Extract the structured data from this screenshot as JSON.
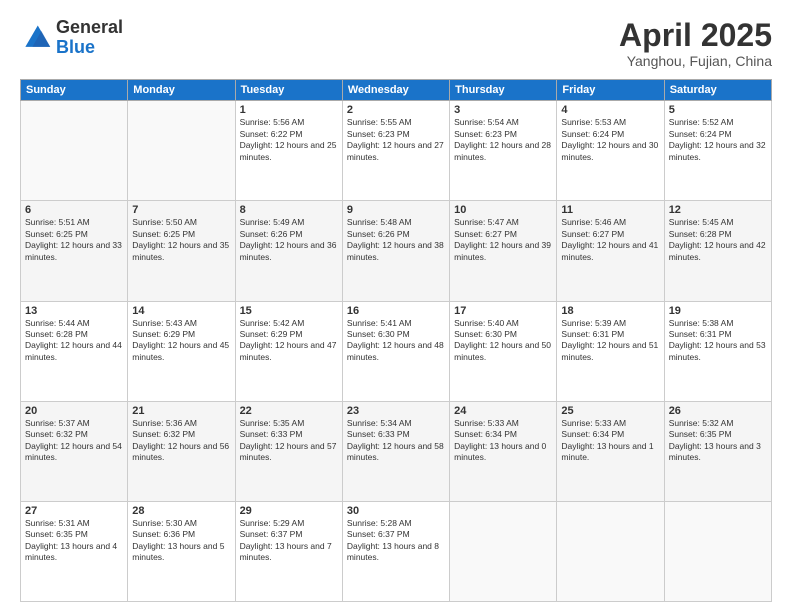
{
  "header": {
    "logo_general": "General",
    "logo_blue": "Blue",
    "month_title": "April 2025",
    "location": "Yanghou, Fujian, China"
  },
  "weekdays": [
    "Sunday",
    "Monday",
    "Tuesday",
    "Wednesday",
    "Thursday",
    "Friday",
    "Saturday"
  ],
  "weeks": [
    [
      {
        "num": "",
        "info": ""
      },
      {
        "num": "",
        "info": ""
      },
      {
        "num": "1",
        "info": "Sunrise: 5:56 AM\nSunset: 6:22 PM\nDaylight: 12 hours and 25 minutes."
      },
      {
        "num": "2",
        "info": "Sunrise: 5:55 AM\nSunset: 6:23 PM\nDaylight: 12 hours and 27 minutes."
      },
      {
        "num": "3",
        "info": "Sunrise: 5:54 AM\nSunset: 6:23 PM\nDaylight: 12 hours and 28 minutes."
      },
      {
        "num": "4",
        "info": "Sunrise: 5:53 AM\nSunset: 6:24 PM\nDaylight: 12 hours and 30 minutes."
      },
      {
        "num": "5",
        "info": "Sunrise: 5:52 AM\nSunset: 6:24 PM\nDaylight: 12 hours and 32 minutes."
      }
    ],
    [
      {
        "num": "6",
        "info": "Sunrise: 5:51 AM\nSunset: 6:25 PM\nDaylight: 12 hours and 33 minutes."
      },
      {
        "num": "7",
        "info": "Sunrise: 5:50 AM\nSunset: 6:25 PM\nDaylight: 12 hours and 35 minutes."
      },
      {
        "num": "8",
        "info": "Sunrise: 5:49 AM\nSunset: 6:26 PM\nDaylight: 12 hours and 36 minutes."
      },
      {
        "num": "9",
        "info": "Sunrise: 5:48 AM\nSunset: 6:26 PM\nDaylight: 12 hours and 38 minutes."
      },
      {
        "num": "10",
        "info": "Sunrise: 5:47 AM\nSunset: 6:27 PM\nDaylight: 12 hours and 39 minutes."
      },
      {
        "num": "11",
        "info": "Sunrise: 5:46 AM\nSunset: 6:27 PM\nDaylight: 12 hours and 41 minutes."
      },
      {
        "num": "12",
        "info": "Sunrise: 5:45 AM\nSunset: 6:28 PM\nDaylight: 12 hours and 42 minutes."
      }
    ],
    [
      {
        "num": "13",
        "info": "Sunrise: 5:44 AM\nSunset: 6:28 PM\nDaylight: 12 hours and 44 minutes."
      },
      {
        "num": "14",
        "info": "Sunrise: 5:43 AM\nSunset: 6:29 PM\nDaylight: 12 hours and 45 minutes."
      },
      {
        "num": "15",
        "info": "Sunrise: 5:42 AM\nSunset: 6:29 PM\nDaylight: 12 hours and 47 minutes."
      },
      {
        "num": "16",
        "info": "Sunrise: 5:41 AM\nSunset: 6:30 PM\nDaylight: 12 hours and 48 minutes."
      },
      {
        "num": "17",
        "info": "Sunrise: 5:40 AM\nSunset: 6:30 PM\nDaylight: 12 hours and 50 minutes."
      },
      {
        "num": "18",
        "info": "Sunrise: 5:39 AM\nSunset: 6:31 PM\nDaylight: 12 hours and 51 minutes."
      },
      {
        "num": "19",
        "info": "Sunrise: 5:38 AM\nSunset: 6:31 PM\nDaylight: 12 hours and 53 minutes."
      }
    ],
    [
      {
        "num": "20",
        "info": "Sunrise: 5:37 AM\nSunset: 6:32 PM\nDaylight: 12 hours and 54 minutes."
      },
      {
        "num": "21",
        "info": "Sunrise: 5:36 AM\nSunset: 6:32 PM\nDaylight: 12 hours and 56 minutes."
      },
      {
        "num": "22",
        "info": "Sunrise: 5:35 AM\nSunset: 6:33 PM\nDaylight: 12 hours and 57 minutes."
      },
      {
        "num": "23",
        "info": "Sunrise: 5:34 AM\nSunset: 6:33 PM\nDaylight: 12 hours and 58 minutes."
      },
      {
        "num": "24",
        "info": "Sunrise: 5:33 AM\nSunset: 6:34 PM\nDaylight: 13 hours and 0 minutes."
      },
      {
        "num": "25",
        "info": "Sunrise: 5:33 AM\nSunset: 6:34 PM\nDaylight: 13 hours and 1 minute."
      },
      {
        "num": "26",
        "info": "Sunrise: 5:32 AM\nSunset: 6:35 PM\nDaylight: 13 hours and 3 minutes."
      }
    ],
    [
      {
        "num": "27",
        "info": "Sunrise: 5:31 AM\nSunset: 6:35 PM\nDaylight: 13 hours and 4 minutes."
      },
      {
        "num": "28",
        "info": "Sunrise: 5:30 AM\nSunset: 6:36 PM\nDaylight: 13 hours and 5 minutes."
      },
      {
        "num": "29",
        "info": "Sunrise: 5:29 AM\nSunset: 6:37 PM\nDaylight: 13 hours and 7 minutes."
      },
      {
        "num": "30",
        "info": "Sunrise: 5:28 AM\nSunset: 6:37 PM\nDaylight: 13 hours and 8 minutes."
      },
      {
        "num": "",
        "info": ""
      },
      {
        "num": "",
        "info": ""
      },
      {
        "num": "",
        "info": ""
      }
    ]
  ]
}
